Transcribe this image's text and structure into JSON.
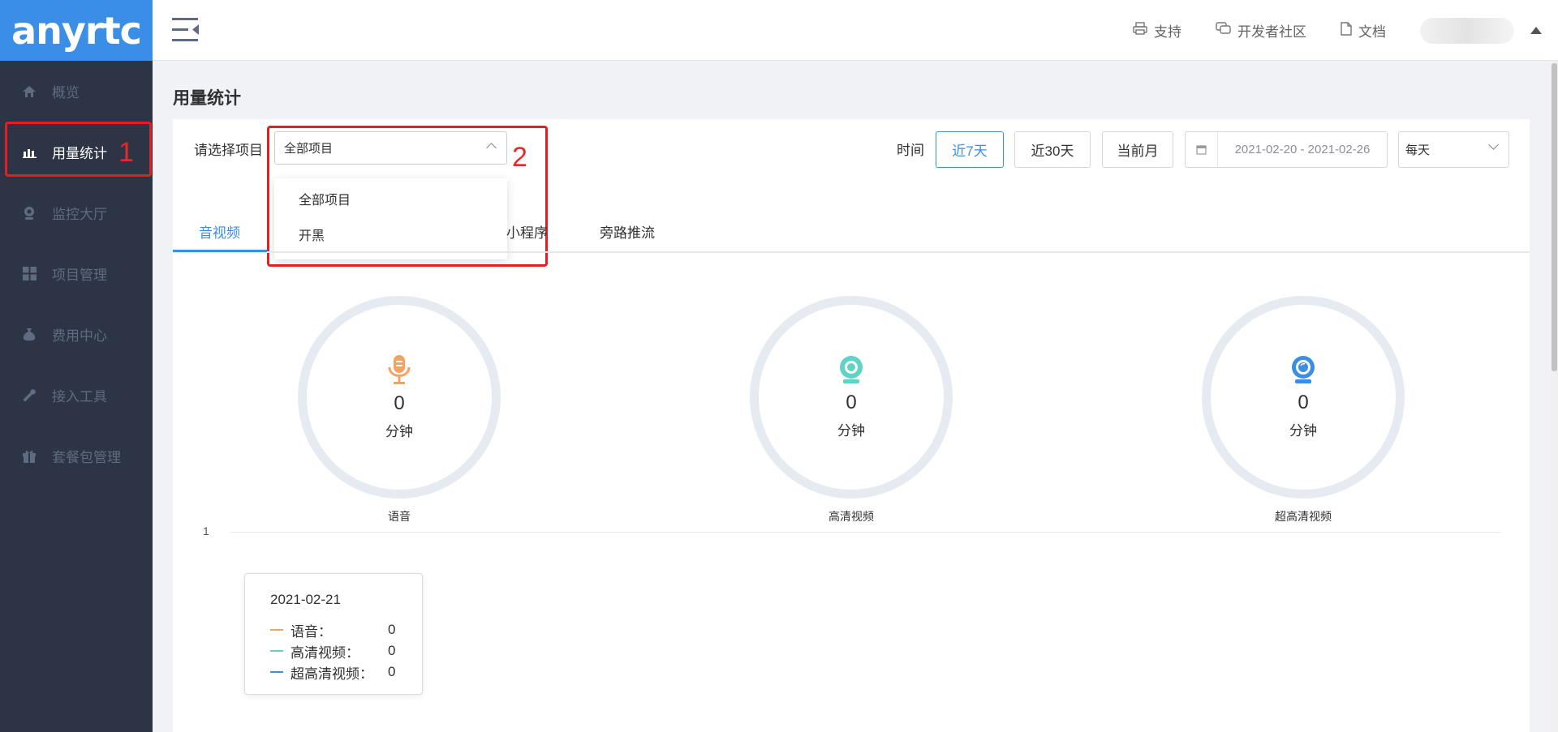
{
  "brand": {
    "logo_text": "anyrtc",
    "accent": "#3a8ee6",
    "sidebar_bg": "#2d3445"
  },
  "sidebar": {
    "items": [
      {
        "label": "概览",
        "icon": "home-icon"
      },
      {
        "label": "用量统计",
        "icon": "bar-chart-icon",
        "active": true,
        "annotation": "1"
      },
      {
        "label": "监控大厅",
        "icon": "webcam-icon"
      },
      {
        "label": "项目管理",
        "icon": "grid-icon"
      },
      {
        "label": "费用中心",
        "icon": "money-bag-icon"
      },
      {
        "label": "接入工具",
        "icon": "wrench-icon"
      },
      {
        "label": "套餐包管理",
        "icon": "gift-icon"
      }
    ]
  },
  "header": {
    "links": [
      {
        "label": "支持",
        "icon": "printer-icon"
      },
      {
        "label": "开发者社区",
        "icon": "chat-icon"
      },
      {
        "label": "文档",
        "icon": "document-icon"
      }
    ]
  },
  "page": {
    "title": "用量统计"
  },
  "filters": {
    "project_label": "请选择项目",
    "project_value": "全部项目",
    "project_options": [
      "全部项目",
      "开黑"
    ],
    "annotation": "2",
    "time_label": "时间",
    "time_buttons": [
      "近7天",
      "近30天",
      "当前月"
    ],
    "time_active": "近7天",
    "date_range": "2021-02-20 - 2021-02-26",
    "period_value": "每天"
  },
  "tabs": {
    "items": [
      "音视频",
      "小程序",
      "旁路推流"
    ],
    "active": "音视频"
  },
  "stats": [
    {
      "label": "语音",
      "value": "0",
      "unit": "分钟",
      "icon": "microphone-icon",
      "color": "#f5a15f"
    },
    {
      "label": "高清视频",
      "value": "0",
      "unit": "分钟",
      "icon": "camera-icon",
      "color": "#5fd3c6"
    },
    {
      "label": "超高清视频",
      "value": "0",
      "unit": "分钟",
      "icon": "hd-camera-icon",
      "color": "#3a8ee6"
    }
  ],
  "chart_data": {
    "type": "line",
    "y_ticks": [
      "1"
    ],
    "series": [
      {
        "name": "语音",
        "color": "#f5a15f"
      },
      {
        "name": "高清视频",
        "color": "#5fd3c6"
      },
      {
        "name": "超高清视频",
        "color": "#3a8ee6"
      }
    ],
    "tooltip": {
      "date": "2021-02-21",
      "rows": [
        {
          "name": "语音：",
          "value": "0"
        },
        {
          "name": "高清视频：",
          "value": "0"
        },
        {
          "name": "超高清视频：",
          "value": "0"
        }
      ]
    }
  }
}
